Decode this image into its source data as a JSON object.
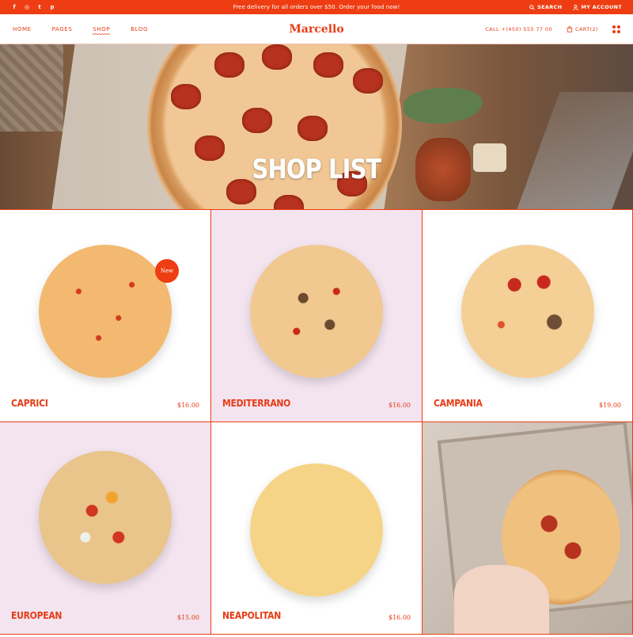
{
  "topbar": {
    "social": [
      "f",
      "◎",
      "t",
      "p"
    ],
    "promo": "Free delivery for all orders over $50. Order your food now!",
    "search": "SEARCH",
    "account": "MY ACCOUNT"
  },
  "nav": {
    "links": [
      "HOME",
      "PAGES",
      "SHOP",
      "BLOG"
    ],
    "active": "SHOP",
    "logo": "Marcello",
    "call": "CALL +(450) 555 77 00",
    "cart": "CART(2)"
  },
  "hero": {
    "title": "SHOP LIST"
  },
  "products": [
    {
      "name": "CAPRICI",
      "price": "$16.00",
      "badge": "New",
      "variant": "capri",
      "bg": "white"
    },
    {
      "name": "MEDITERRANO",
      "price": "$16.00",
      "variant": "medi",
      "bg": "pink"
    },
    {
      "name": "CAMPANIA",
      "price": "$19.00",
      "variant": "camp",
      "bg": "white"
    },
    {
      "name": "EUROPEAN",
      "price": "$15.00",
      "variant": "euro",
      "bg": "pink"
    },
    {
      "name": "NEAPOLITAN",
      "price": "$16.00",
      "variant": "neap",
      "bg": "white"
    }
  ],
  "colors": {
    "accent": "#ee3d12",
    "pink_bg": "#f3e4f0"
  }
}
